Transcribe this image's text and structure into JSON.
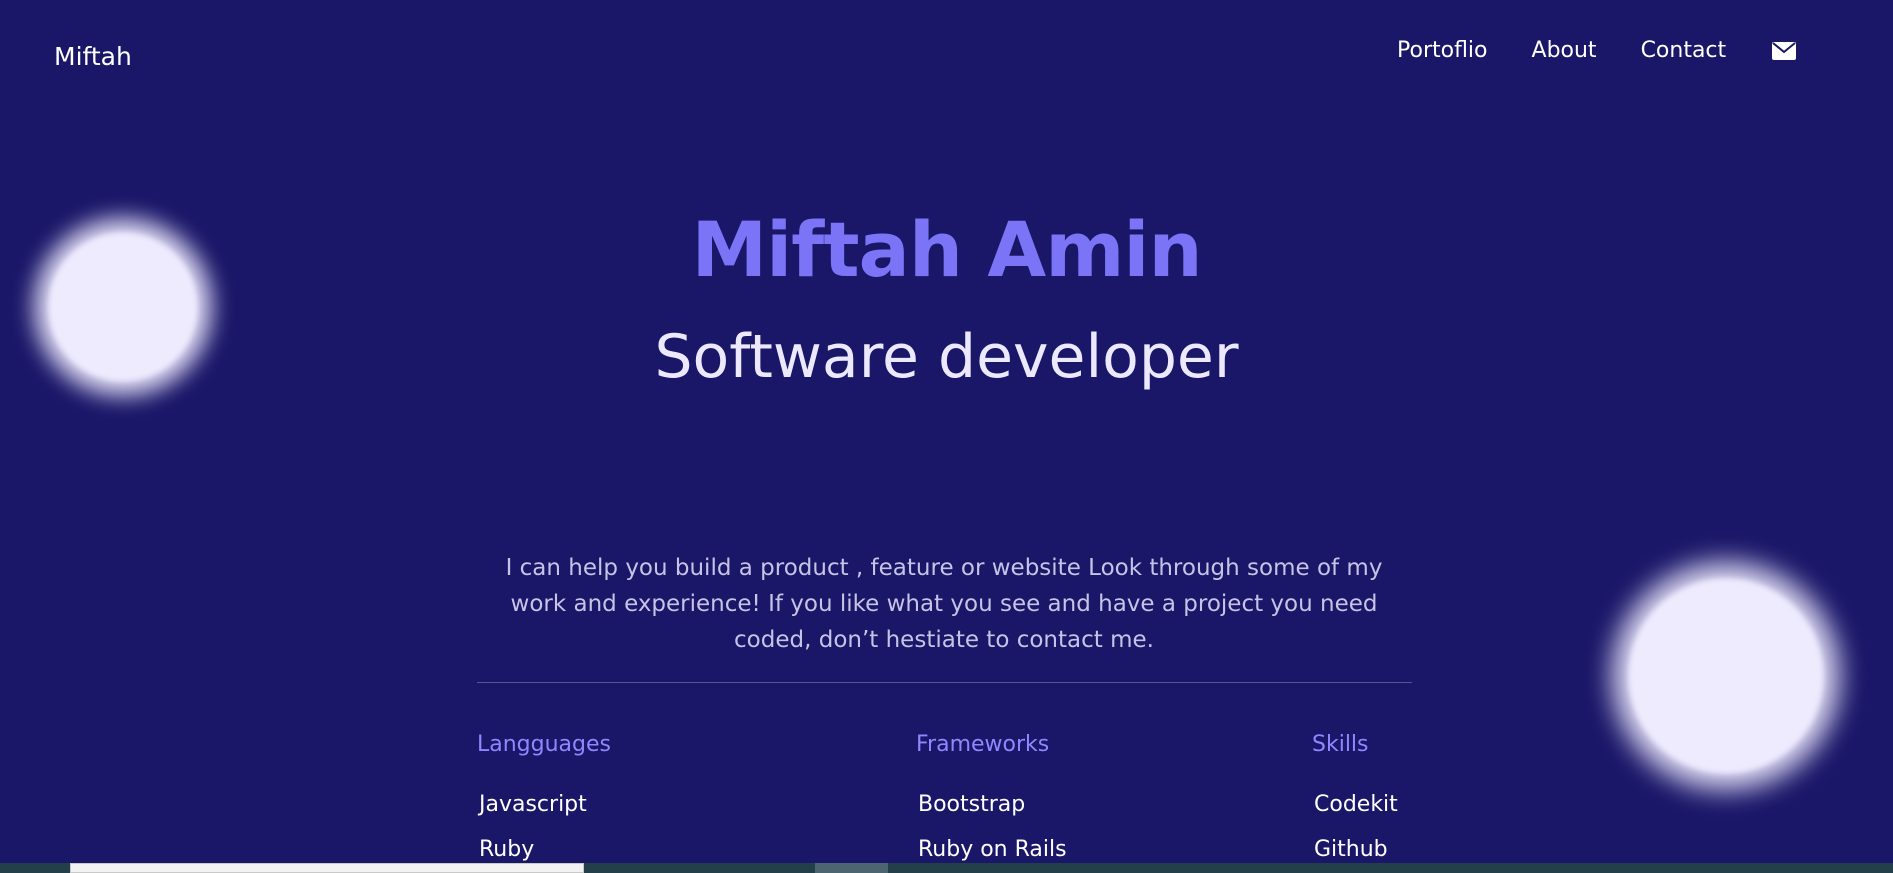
{
  "nav": {
    "brand": "Miftah",
    "links": [
      "Portoflio",
      "About",
      "Contact"
    ],
    "mail_icon": "envelope-icon"
  },
  "hero": {
    "name": "Miftah Amin",
    "role": "Software developer"
  },
  "intro": {
    "text": "I can help you build a product , feature or website Look through some of my work and experience! If you like what you see and have a project you need coded, don’t hestiate to contact me."
  },
  "skills": {
    "languages": {
      "title": "Langguages",
      "items": [
        "Javascript",
        "Ruby"
      ]
    },
    "frameworks": {
      "title": "Frameworks",
      "items": [
        "Bootstrap",
        "Ruby on Rails"
      ]
    },
    "skills": {
      "title": "Skills",
      "items": [
        "Codekit",
        "Github"
      ]
    }
  },
  "colors": {
    "background": "#1a1668",
    "accent": "#7b74f6",
    "heading_secondary": "#8e88ff",
    "text": "#ffffff",
    "muted_text": "#c6c3e6",
    "blob": "#eeebff"
  }
}
